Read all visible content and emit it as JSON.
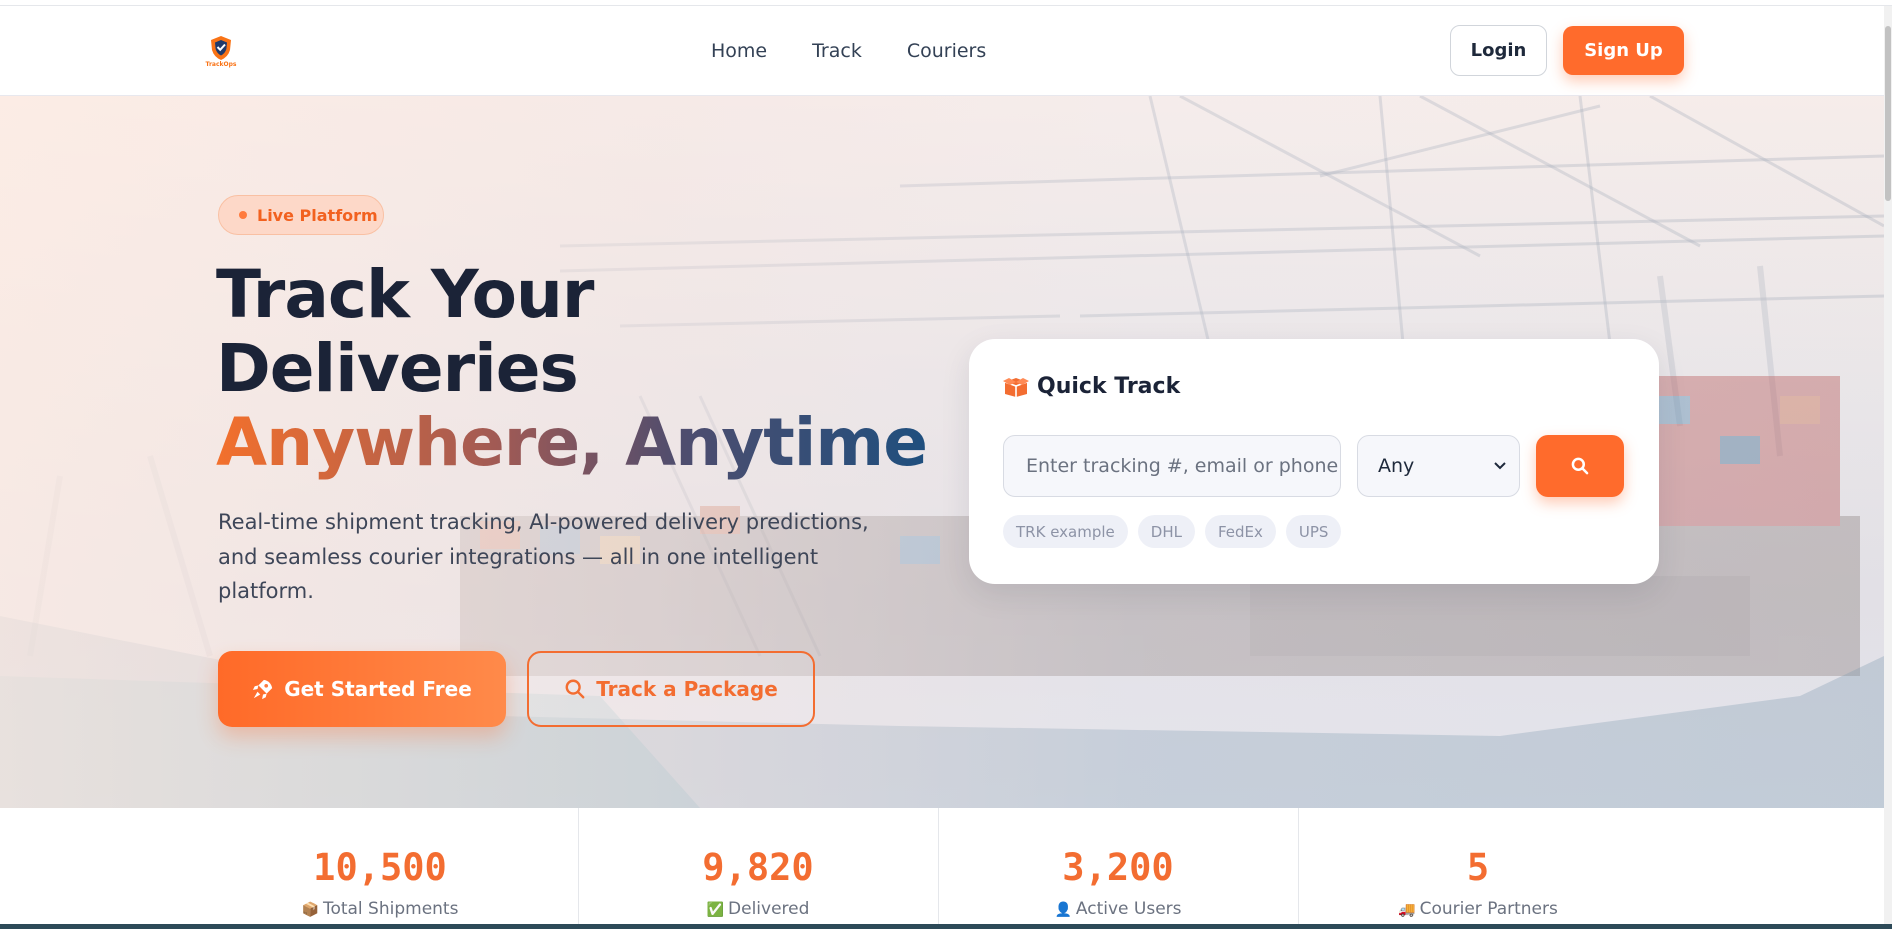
{
  "brand": {
    "logo_text": "TrackOps",
    "accent": "#ff6b2c"
  },
  "nav": {
    "links": [
      "Home",
      "Track",
      "Couriers"
    ],
    "login_label": "Login",
    "signup_label": "Sign Up"
  },
  "hero": {
    "badge": "Live Platform",
    "title_line1": "Track Your",
    "title_line2": "Deliveries",
    "title_line3": "Anywhere, Anytime",
    "subtitle": "Real-time shipment tracking, AI-powered delivery predictions, and seamless courier integrations — all in one intelligent platform.",
    "primary_cta": "Get Started Free",
    "secondary_cta": "Track a Package"
  },
  "quick_track": {
    "title": "Quick Track",
    "input_placeholder": "Enter tracking #, email or phone",
    "courier_selected": "Any",
    "chips": [
      "TRK example",
      "DHL",
      "FedEx",
      "UPS"
    ]
  },
  "stats": [
    {
      "value": "10,500",
      "label": "Total Shipments",
      "icon": "📦"
    },
    {
      "value": "9,820",
      "label": "Delivered",
      "icon": "✅"
    },
    {
      "value": "3,200",
      "label": "Active Users",
      "icon": "👤"
    },
    {
      "value": "5",
      "label": "Courier Partners",
      "icon": "🚚"
    }
  ]
}
